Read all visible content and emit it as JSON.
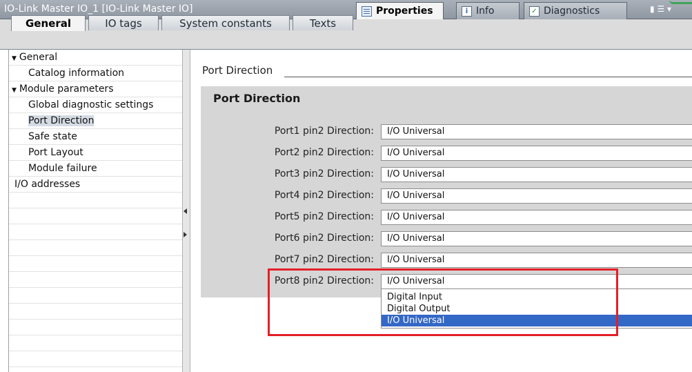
{
  "window": {
    "title": "IO-Link Master IO_1 [IO-Link Master IO]",
    "panel_tabs": [
      {
        "label": "Properties",
        "active": true,
        "icon": "properties-icon"
      },
      {
        "label": "Info",
        "active": false,
        "icon": "info-icon"
      },
      {
        "label": "Diagnostics",
        "active": false,
        "icon": "diagnostics-icon"
      }
    ]
  },
  "tabs": [
    {
      "label": "General",
      "active": true
    },
    {
      "label": "IO tags",
      "active": false
    },
    {
      "label": "System constants",
      "active": false
    },
    {
      "label": "Texts",
      "active": false
    }
  ],
  "tree": [
    {
      "label": "General",
      "expanded": true
    },
    {
      "label": "Catalog information"
    },
    {
      "label": "Module parameters",
      "expanded": true
    },
    {
      "label": "Global diagnostic settings"
    },
    {
      "label": "Port Direction",
      "selected": true
    },
    {
      "label": "Safe state"
    },
    {
      "label": "Port Layout"
    },
    {
      "label": "Module failure"
    },
    {
      "label": "I/O addresses"
    }
  ],
  "content": {
    "section_title": "Port Direction",
    "panel_title": "Port Direction",
    "rows": [
      {
        "label": "Port1 pin2 Direction:",
        "value": "I/O Universal"
      },
      {
        "label": "Port2 pin2 Direction:",
        "value": "I/O Universal"
      },
      {
        "label": "Port3 pin2 Direction:",
        "value": "I/O Universal"
      },
      {
        "label": "Port4 pin2 Direction:",
        "value": "I/O Universal"
      },
      {
        "label": "Port5 pin2 Direction:",
        "value": "I/O Universal"
      },
      {
        "label": "Port6 pin2 Direction:",
        "value": "I/O Universal"
      },
      {
        "label": "Port7 pin2 Direction:",
        "value": "I/O Universal"
      },
      {
        "label": "Port8 pin2 Direction:",
        "value": "I/O Universal"
      }
    ],
    "dropdown_options": [
      {
        "label": "Digital Input",
        "selected": false
      },
      {
        "label": "Digital Output",
        "selected": false
      },
      {
        "label": "I/O Universal",
        "selected": true
      }
    ]
  },
  "colors": {
    "selection_blue": "#3468c6",
    "highlight_red": "#e41e26",
    "titlebar_gray": "#9aa2ac"
  }
}
